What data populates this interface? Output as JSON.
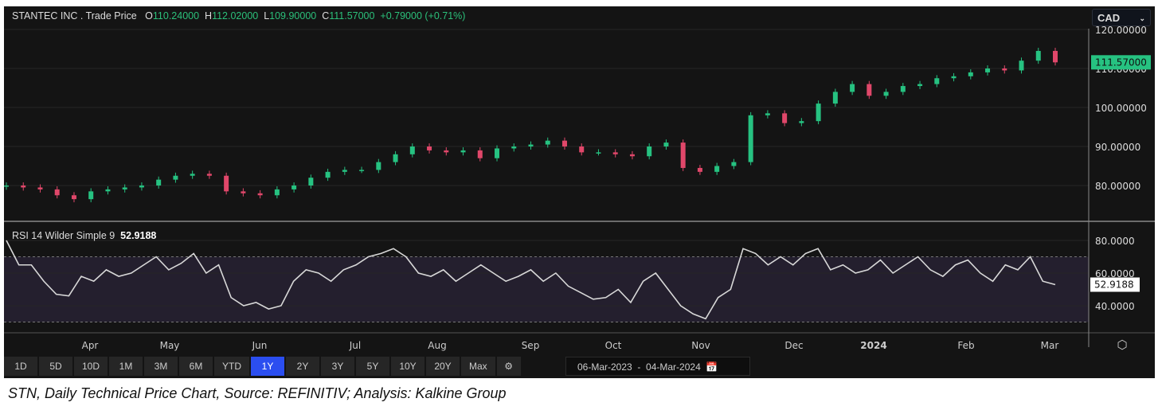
{
  "header": {
    "title": "STANTEC INC . Trade Price",
    "o_label": "O",
    "o": "110.24000",
    "h_label": "H",
    "h": "112.02000",
    "l_label": "L",
    "l": "109.90000",
    "c_label": "C",
    "c": "111.57000",
    "change": "+0.79000 (+0.71%)"
  },
  "currency": "CAD",
  "rsi": {
    "label": "RSI 14 Wilder Simple 9",
    "value": "52.9188"
  },
  "range_buttons": [
    "1D",
    "5D",
    "10D",
    "1M",
    "3M",
    "6M",
    "YTD",
    "1Y",
    "2Y",
    "3Y",
    "5Y",
    "10Y",
    "20Y",
    "Max"
  ],
  "active_range": "1Y",
  "date_range": {
    "from": "06-Mar-2023",
    "sep": "-",
    "to": "04-Mar-2024"
  },
  "caption": "STN, Daily Technical Price Chart, Source: REFINITIV; Analysis: Kalkine Group",
  "colors": {
    "up": "#26c281",
    "down": "#e0476a",
    "rsi_line": "#d8d8d8",
    "rsi_band": "#241f2e",
    "bg": "#141414"
  },
  "chart_data": [
    {
      "type": "candlestick",
      "title": "STANTEC INC . Trade Price",
      "x_range": [
        "2023-03-06",
        "2024-03-04"
      ],
      "ylim": [
        72,
        122
      ],
      "yticks": [
        "120.00000",
        "110.00000",
        "100.00000",
        "90.00000",
        "80.00000"
      ],
      "ytick_values": [
        120,
        110,
        100,
        90,
        80
      ],
      "xticks": [
        "Apr",
        "May",
        "Jun",
        "Jul",
        "Aug",
        "Sep",
        "Oct",
        "Nov",
        "Dec",
        "2024",
        "Feb",
        "Mar"
      ],
      "last_price_label": "111.57000",
      "weekly_close": [
        80,
        79.5,
        79,
        77.5,
        76.5,
        78.5,
        79,
        79.5,
        80,
        81.5,
        82.5,
        83,
        82.5,
        78.5,
        78,
        77.5,
        79,
        80,
        82,
        83.5,
        84,
        84,
        86,
        88,
        90,
        89,
        88.5,
        89,
        87,
        89.5,
        90,
        90.5,
        91.5,
        90,
        88.5,
        88.5,
        88,
        87.5,
        90,
        91,
        84.5,
        83.5,
        85,
        86,
        98,
        98.5,
        96,
        96.5,
        101,
        104,
        106,
        103,
        104,
        105.5,
        106,
        107.5,
        108,
        109,
        110,
        109.5,
        112,
        114.5,
        111.57
      ]
    },
    {
      "type": "line",
      "title": "RSI 14 Wilder Simple 9",
      "ylim": [
        25,
        88
      ],
      "yticks": [
        "80.0000",
        "60.0000",
        "40.0000"
      ],
      "ytick_values": [
        80,
        60,
        40
      ],
      "bands": [
        30,
        70
      ],
      "values": [
        80,
        65,
        65,
        55,
        47,
        46,
        58,
        55,
        62,
        58,
        60,
        65,
        70,
        62,
        66,
        72,
        60,
        65,
        45,
        40,
        42,
        38,
        40,
        55,
        62,
        60,
        55,
        62,
        65,
        70,
        72,
        75,
        70,
        60,
        58,
        62,
        55,
        60,
        65,
        60,
        55,
        58,
        62,
        55,
        60,
        52,
        48,
        44,
        45,
        50,
        42,
        55,
        60,
        50,
        40,
        35,
        32,
        45,
        50,
        75,
        72,
        65,
        70,
        65,
        72,
        75,
        62,
        65,
        60,
        62,
        68,
        60,
        65,
        70,
        62,
        58,
        65,
        68,
        60,
        55,
        65,
        62,
        70,
        55,
        52.9188
      ]
    }
  ]
}
